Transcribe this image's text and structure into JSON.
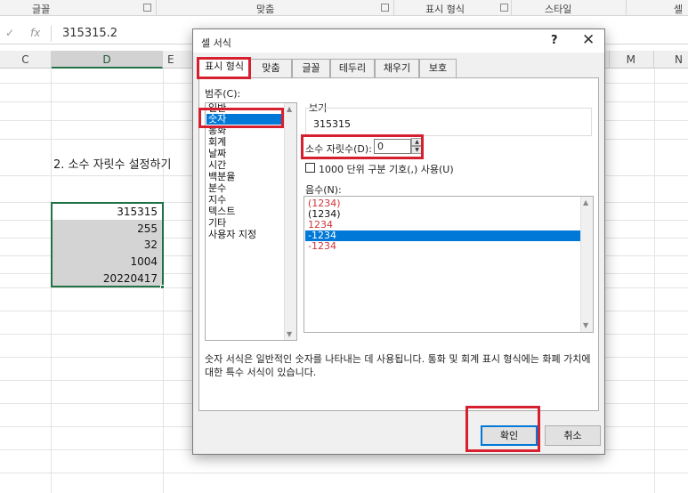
{
  "ribbon": {
    "groups": [
      "글꼴",
      "맞춤",
      "표시 형식",
      "스타일",
      "셀"
    ]
  },
  "formula_bar": {
    "cancel_icon": "✓",
    "fx_label": "fx",
    "value": "315315.2"
  },
  "columns": {
    "c": "C",
    "d": "D",
    "e": "E",
    "m": "M",
    "n": "N"
  },
  "sheet": {
    "title": "2. 소수 자릿수 설정하기",
    "cells": [
      "315315",
      "255",
      "32",
      "1004",
      "20220417"
    ]
  },
  "dialog": {
    "title": "셀 서식",
    "help": "?",
    "close": "✕",
    "tabs": [
      "표시 형식",
      "맞춤",
      "글꼴",
      "테두리",
      "채우기",
      "보호"
    ],
    "category_label": "범주(C):",
    "categories": [
      "일반",
      "숫자",
      "통화",
      "회계",
      "날짜",
      "시간",
      "백분율",
      "분수",
      "지수",
      "텍스트",
      "기타",
      "사용자 지정"
    ],
    "selected_category": "숫자",
    "sample_label": "보기",
    "sample_value": "315315",
    "decimal_label": "소수 자릿수(D):",
    "decimal_value": "0",
    "thousands_label": "1000 단위 구분 기호(,) 사용(U)",
    "negative_label": "음수(N):",
    "negative_options": [
      {
        "text": "(1234)",
        "color": "#d13438"
      },
      {
        "text": "(1234)",
        "color": "#111111"
      },
      {
        "text": "1234",
        "color": "#d13438"
      },
      {
        "text": "-1234",
        "color": "#ffffff"
      },
      {
        "text": "-1234",
        "color": "#d13438"
      }
    ],
    "description": "숫자 서식은 일반적인 숫자를 나타내는 데 사용됩니다. 통화 및 회계 표시 형식에는 화폐 가치에 대한 특수 서식이 있습니다.",
    "ok_label": "확인",
    "cancel_label": "취소"
  },
  "icons": {
    "spin_up": "▲",
    "spin_down": "▼",
    "scroll_up": "▲",
    "scroll_down": "▼",
    "launcher": "dialog-launcher-icon"
  },
  "colors": {
    "excel_green": "#217346",
    "selection_blue": "#0078d7",
    "highlight_red": "#d6202f",
    "negative_red": "#d13438"
  }
}
